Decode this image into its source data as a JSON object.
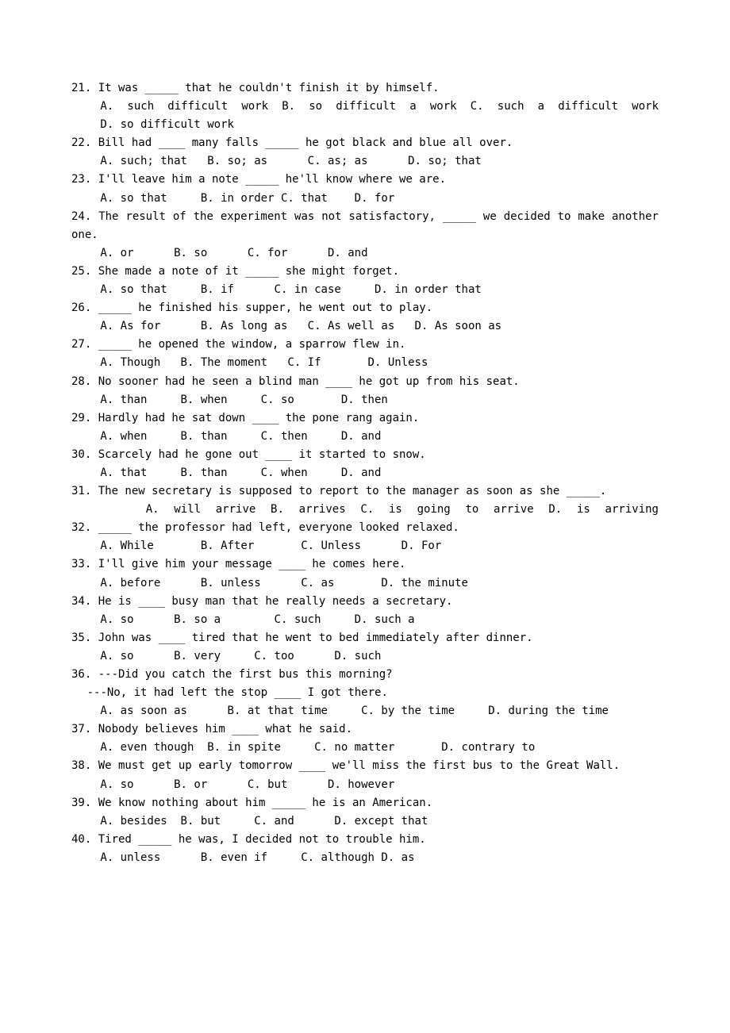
{
  "questions": [
    {
      "num": "21.",
      "stem": "It was _____ that he couldn't finish it by himself.",
      "choices_line1": "A. such difficult work  B. so difficult a work  C.  such  a  difficult  work",
      "choices_line2": "D. so difficult work",
      "blankPadLeft": true,
      "justifyChoices1": true
    },
    {
      "num": "22.",
      "stem": "Bill had ____ many falls _____ he got black and blue all over.",
      "choices_line1": "A. such; that   B. so; as      C. as; as      D. so; that",
      "blankPadLeft": true
    },
    {
      "num": "23.",
      "stem": "I'll leave him a note _____ he'll know where we are.",
      "choices_line1": "A. so that     B. in order C. that    D. for",
      "blankPadLeft": true
    },
    {
      "num": "24.",
      "stem": "The result of the experiment was not satisfactory, _____ we decided to make another one.",
      "choices_line1": "A. or      B. so      C. for      D. and",
      "blankPadLeft": true,
      "wrapSecondLineNoIndent": true,
      "justifyStem": true
    },
    {
      "num": "25.",
      "stem": "She made a note of it _____ she might forget.",
      "choices_line1": "A. so that     B. if      C. in case     D. in order that",
      "blankPadLeft": true
    },
    {
      "num": "26.",
      "stem": "_____ he finished his supper, he went out to play.",
      "choices_line1": "A. As for      B. As long as   C. As well as   D. As soon as",
      "blankPadLeft": true
    },
    {
      "num": "27.",
      "stem": "_____ he opened the window, a sparrow flew in.",
      "choices_line1": "A. Though   B. The moment   C. If       D. Unless",
      "blankPadLeft": true
    },
    {
      "num": "28.",
      "stem": "No sooner had he seen a blind man ____ he got up from his seat.",
      "choices_line1": "A. than     B. when     C. so       D. then",
      "blankPadLeft": true
    },
    {
      "num": "29.",
      "stem": "Hardly had he sat down ____ the pone rang again.",
      "choices_line1": "A. when     B. than     C. then     D. and",
      "blankPadLeft": true
    },
    {
      "num": "30.",
      "stem": "Scarcely had he gone out ____ it started to snow.",
      "choices_line1": "A. that     B. than     C. when     D. and",
      "blankPadLeft": true
    },
    {
      "num": "31.",
      "stem": "The new secretary is supposed to report to the manager as soon as she _____.",
      "choices_line1": "A. will arrive     B. arrives     C. is going to arrive      D.        is arriving",
      "blankPadLeft": true,
      "justifyChoices1": true,
      "choices1WrapNoIndent": true
    },
    {
      "num": "32.",
      "stem": "_____ the professor had left, everyone looked relaxed.",
      "choices_line1": "A. While       B. After       C. Unless      D. For",
      "blankPadLeft": true
    },
    {
      "num": "33.",
      "stem": "I'll give him your message ____ he comes here.",
      "choices_line1": "A. before      B. unless      C. as       D. the minute",
      "blankPadLeft": true
    },
    {
      "num": "34.",
      "stem": "He is ____ busy man that he really needs a secretary.",
      "choices_line1": "A. so      B. so a        C. such     D. such a",
      "blankPadLeft": true
    },
    {
      "num": "35.",
      "stem": "John was ____ tired that he went to bed immediately after dinner.",
      "choices_line1": "A. so      B. very     C. too      D. such",
      "blankPadLeft": true
    },
    {
      "num": "36.",
      "stem": "---Did you catch the first bus this morning?",
      "stem2": "---No, it had left the stop ____ I got there.",
      "choices_line1": "A. as soon as      B. at that time     C. by the time     D. during the time",
      "blankPadLeft": true,
      "stem2PadLeft": true
    },
    {
      "num": "37.",
      "stem": "Nobody believes him ____ what he said.",
      "choices_line1": "A. even though  B. in spite     C. no matter       D. contrary to",
      "blankPadLeft": true
    },
    {
      "num": "38.",
      "stem": "We must get up early tomorrow ____ we'll miss the first bus to the Great Wall.",
      "choices_line1": "A. so      B. or      C. but      D. however",
      "blankPadLeft": true
    },
    {
      "num": "39.",
      "stem": "We know nothing about him _____ he is an American.",
      "choices_line1": "A. besides  B. but     C. and      D. except that",
      "blankPadLeft": true
    },
    {
      "num": "40.",
      "stem": "Tired _____ he was, I decided not to trouble him.",
      "choices_line1": "A. unless      B. even if     C. although D. as",
      "blankPadLeft": true
    }
  ]
}
